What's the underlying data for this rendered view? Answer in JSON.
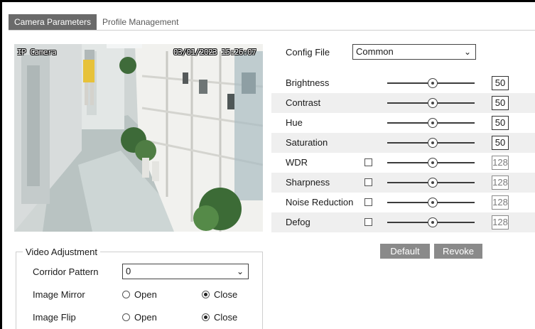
{
  "tabs": [
    {
      "label": "Camera Parameters",
      "active": true
    },
    {
      "label": "Profile Management",
      "active": false
    }
  ],
  "preview": {
    "camera_name": "IP Camera",
    "timestamp": "03/01/2023 15:26:07"
  },
  "config": {
    "label": "Config File",
    "value": "Common"
  },
  "params": [
    {
      "label": "Brightness",
      "value": "50",
      "checkbox": false,
      "enabled": true,
      "level": 0.5
    },
    {
      "label": "Contrast",
      "value": "50",
      "checkbox": false,
      "enabled": true,
      "level": 0.5
    },
    {
      "label": "Hue",
      "value": "50",
      "checkbox": false,
      "enabled": true,
      "level": 0.5
    },
    {
      "label": "Saturation",
      "value": "50",
      "checkbox": false,
      "enabled": true,
      "level": 0.5
    },
    {
      "label": "WDR",
      "value": "128",
      "checkbox": true,
      "enabled": false,
      "level": 0.5
    },
    {
      "label": "Sharpness",
      "value": "128",
      "checkbox": true,
      "enabled": false,
      "level": 0.5
    },
    {
      "label": "Noise Reduction",
      "value": "128",
      "checkbox": true,
      "enabled": false,
      "level": 0.5
    },
    {
      "label": "Defog",
      "value": "128",
      "checkbox": true,
      "enabled": false,
      "level": 0.5
    }
  ],
  "buttons": {
    "default_label": "Default",
    "revoke_label": "Revoke"
  },
  "video_adjustment": {
    "legend": "Video Adjustment",
    "corridor_label": "Corridor Pattern",
    "corridor_value": "0",
    "mirror_label": "Image Mirror",
    "flip_label": "Image Flip",
    "open_label": "Open",
    "close_label": "Close",
    "mirror_selected": "Close",
    "flip_selected": "Close"
  },
  "colors": {
    "active_tab": "#6a6a6a",
    "button": "#8a8a8a",
    "row_shade": "#efefef"
  }
}
